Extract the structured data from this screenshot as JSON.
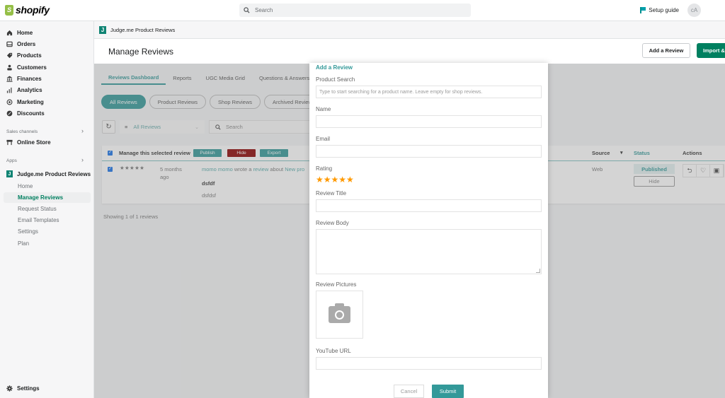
{
  "topbar": {
    "logo_text": "shopify",
    "search_placeholder": "Search",
    "setup_guide": "Setup guide",
    "avatar_initials": "cA"
  },
  "sidebar": {
    "items": [
      {
        "label": "Home",
        "icon": "home-icon"
      },
      {
        "label": "Orders",
        "icon": "inbox-icon"
      },
      {
        "label": "Products",
        "icon": "tag-icon"
      },
      {
        "label": "Customers",
        "icon": "person-icon"
      },
      {
        "label": "Finances",
        "icon": "bank-icon"
      },
      {
        "label": "Analytics",
        "icon": "bar-chart-icon"
      },
      {
        "label": "Marketing",
        "icon": "target-icon"
      },
      {
        "label": "Discounts",
        "icon": "discount-icon"
      }
    ],
    "sales_channels_label": "Sales channels",
    "online_store": "Online Store",
    "apps_label": "Apps",
    "app_name": "Judge.me Product Reviews",
    "app_badge": "J",
    "app_sub_items": [
      "Home",
      "Manage Reviews",
      "Request Status",
      "Email Templates",
      "Settings",
      "Plan"
    ],
    "active_sub_item": "Manage Reviews",
    "settings": "Settings"
  },
  "breadcrumb": {
    "badge": "J",
    "app_name": "Judge.me Product Reviews"
  },
  "page": {
    "title": "Manage Reviews",
    "add_review_button": "Add a Review",
    "import_button": "Import &"
  },
  "tabs": [
    "Reviews Dashboard",
    "Reports",
    "UGC Media Grid",
    "Questions & Answers"
  ],
  "active_tab": "Reviews Dashboard",
  "pills": [
    "All Reviews",
    "Product Reviews",
    "Shop Reviews",
    "Archived Reviews"
  ],
  "active_pill": "All Reviews",
  "filter": {
    "selected": "All Reviews",
    "search_placeholder": "Search"
  },
  "table": {
    "bulk_label": "Manage this selected review",
    "bulk_actions": {
      "publish": "Publish",
      "hide": "Hide",
      "export": "Export"
    },
    "columns": {
      "source": "Source",
      "status": "Status",
      "actions": "Actions"
    },
    "rows": [
      {
        "checked": true,
        "rating": 5,
        "stars": "★★★★★",
        "time_line1": "5 months",
        "time_line2": "ago",
        "author": "momo momo",
        "wrote_a": "wrote a",
        "review_link": "review",
        "about": "about",
        "product": "New pro",
        "title": "dsfdf",
        "body": "dsfdsf",
        "source": "Web",
        "status": "Published",
        "toggle_label": "Hide"
      }
    ],
    "footer": "Showing 1 of 1 reviews"
  },
  "modal": {
    "title": "Add a Review",
    "product_search_label": "Product Search",
    "product_search_placeholder": "Type to start searching for a product name. Leave empty for shop reviews.",
    "name_label": "Name",
    "name_value": "",
    "email_label": "Email",
    "email_value": "",
    "rating_label": "Rating",
    "rating_value": 5,
    "rating_stars": "★★★★★",
    "review_title_label": "Review Title",
    "review_title_value": "",
    "review_body_label": "Review Body",
    "review_body_value": "",
    "review_pictures_label": "Review Pictures",
    "youtube_label": "YouTube URL",
    "youtube_value": "",
    "cancel_button": "Cancel",
    "submit_button": "Submit"
  },
  "colors": {
    "brand_teal": "#339999",
    "shopify_green": "#008060",
    "star_orange": "#ff9900",
    "hide_red": "#8b0000"
  }
}
